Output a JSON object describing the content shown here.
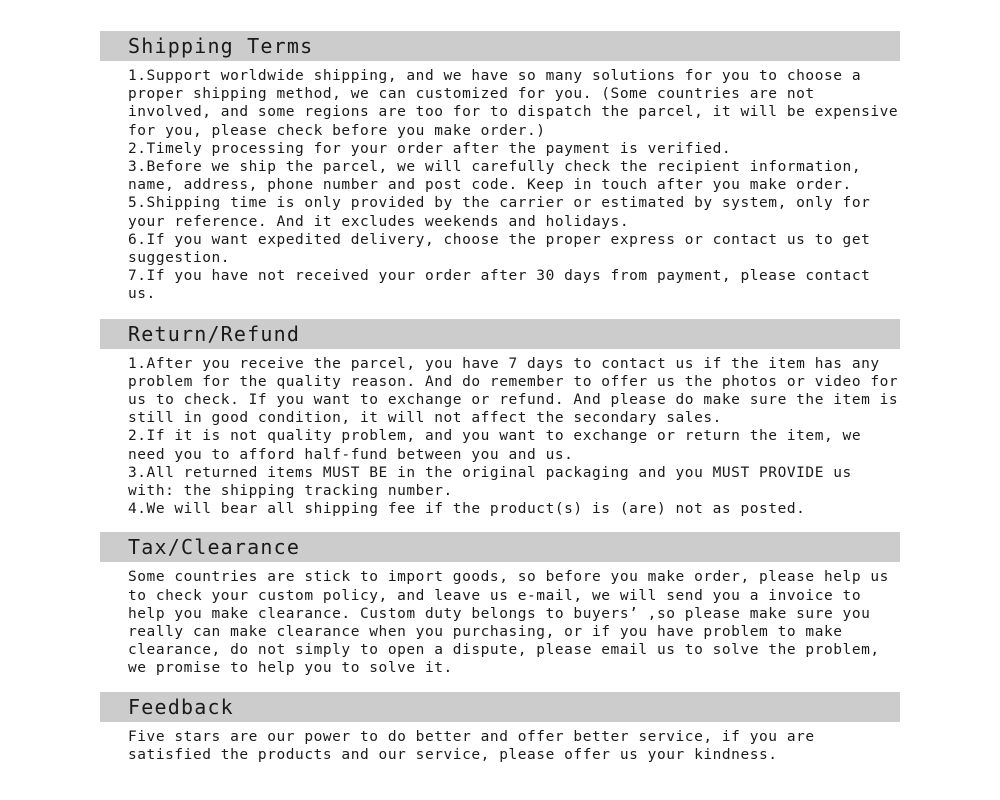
{
  "theme": {
    "header_bg": "#cccccc",
    "page_bg": "#ffffff",
    "text_color": "#1a1a1a"
  },
  "sections": [
    {
      "id": "shipping",
      "title": "Shipping Terms",
      "body": "1.Support worldwide shipping, and we have so many solutions for you to choose a proper shipping method, we can customized for you. (Some countries are not involved, and some regions are too for to dispatch the parcel, it will be expensive for you, please check before you make order.)\n2.Timely processing for your order after the payment is verified.\n3.Before we ship the parcel, we will carefully check the recipient information, name, address, phone number and post code. Keep in touch after you make order.\n5.Shipping time is only provided by the carrier or estimated by system, only for your reference. And it excludes weekends and holidays.\n6.If you want expedited delivery, choose the proper express or contact us to get suggestion.\n7.If you have not received your order after 30 days from payment, please contact us."
    },
    {
      "id": "return",
      "title": "Return/Refund",
      "body": "1.After you receive the parcel, you have 7 days to contact us if the item has any problem for the quality reason. And do remember to offer us the photos or video for us to check. If you want to exchange or refund. And please do make sure the item is still in good condition, it will not affect the secondary sales.\n2.If it is not quality problem, and you want to exchange or return the item, we need you to afford half-fund between you and us.\n3.All returned items MUST BE in the original packaging and you MUST PROVIDE us with: the shipping tracking number.\n4.We will bear all shipping fee if the product(s) is (are) not as posted."
    },
    {
      "id": "tax",
      "title": "Tax/Clearance",
      "body": "Some countries are stick to import goods, so before you make order, please help us to check your custom policy, and leave us e-mail, we will send you a invoice to help you make clearance. Custom duty belongs to buyers’ ,so please make sure you really can make clearance when you purchasing, or if you have problem to make clearance, do not simply to open a dispute, please email us to solve the problem, we promise to help you to solve it."
    },
    {
      "id": "feedback",
      "title": "Feedback",
      "body": "Five stars are our power to do better and offer better service, if you are satisfied the products and our service, please offer us your kindness."
    }
  ]
}
